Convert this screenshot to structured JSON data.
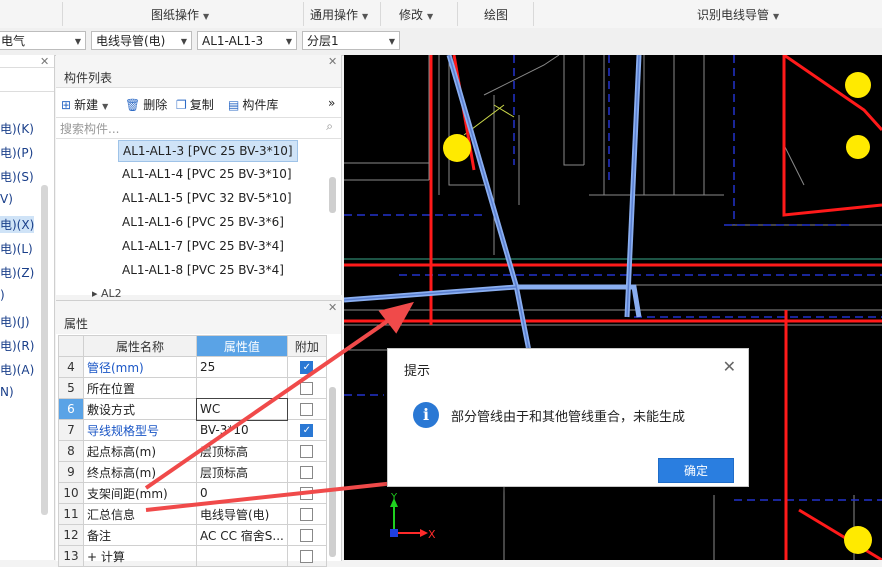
{
  "ribbon": {
    "drawing_ops": "图纸操作",
    "general_ops": "通用操作",
    "modify": "修改",
    "draw": "绘图",
    "identify_wire": "识别电线导管"
  },
  "dropdowns": {
    "discipline": "电气",
    "type": "电线导管(电)",
    "component": "AL1-AL1-3",
    "layer": "分层1"
  },
  "categories": [
    {
      "label": "电)(K)"
    },
    {
      "label": "电)(P)"
    },
    {
      "label": "电)(S)"
    },
    {
      "label": "V)"
    },
    {
      "label": "电)(X)",
      "selected": true
    },
    {
      "label": "电)(L)"
    },
    {
      "label": "电)(Z)"
    },
    {
      "label": ")"
    },
    {
      "label": "电)(J)"
    },
    {
      "label": "电)(R)"
    },
    {
      "label": "电)(A)"
    },
    {
      "label": "N)"
    }
  ],
  "component_list": {
    "title": "构件列表",
    "new_label": "新建",
    "delete_label": "删除",
    "copy_label": "复制",
    "library_label": "构件库",
    "search_placeholder": "搜索构件...",
    "items": [
      {
        "label": "AL1-AL1-3 [PVC 25 BV-3*10]",
        "selected": true
      },
      {
        "label": "AL1-AL1-4 [PVC 25 BV-3*10]"
      },
      {
        "label": "AL1-AL1-5 [PVC 32 BV-5*10]"
      },
      {
        "label": "AL1-AL1-6 [PVC 25 BV-3*6]"
      },
      {
        "label": "AL1-AL1-7 [PVC 25 BV-3*4]"
      },
      {
        "label": "AL1-AL1-8 [PVC 25 BV-3*4]"
      }
    ],
    "collapsed_group": "AL2"
  },
  "properties": {
    "title": "属性",
    "col_name": "属性名称",
    "col_value": "属性值",
    "col_attach": "附加",
    "rows": [
      {
        "idx": "4",
        "name": "管径(mm)",
        "value": "25",
        "checked": true,
        "blue": true
      },
      {
        "idx": "5",
        "name": "所在位置",
        "value": "",
        "checked": false
      },
      {
        "idx": "6",
        "name": "敷设方式",
        "value": "WC",
        "checked": false,
        "selected": true
      },
      {
        "idx": "7",
        "name": "导线规格型号",
        "value": "BV-3*10",
        "checked": true,
        "blue": true
      },
      {
        "idx": "8",
        "name": "起点标高(m)",
        "value": "层顶标高",
        "checked": false
      },
      {
        "idx": "9",
        "name": "终点标高(m)",
        "value": "层顶标高",
        "checked": false
      },
      {
        "idx": "10",
        "name": "支架间距(mm)",
        "value": "0",
        "checked": false
      },
      {
        "idx": "11",
        "name": "汇总信息",
        "value": "电线导管(电)",
        "checked": false
      },
      {
        "idx": "12",
        "name": "备注",
        "value": "AC CC 宿舍S...",
        "checked": false
      },
      {
        "idx": "13",
        "name": "+ 计算",
        "value": "",
        "checked": false
      }
    ]
  },
  "axes": {
    "y": "Y",
    "x": "X"
  },
  "dialog": {
    "title": "提示",
    "message": "部分管线由于和其他管线重合，未能生成",
    "ok_label": "确定"
  }
}
